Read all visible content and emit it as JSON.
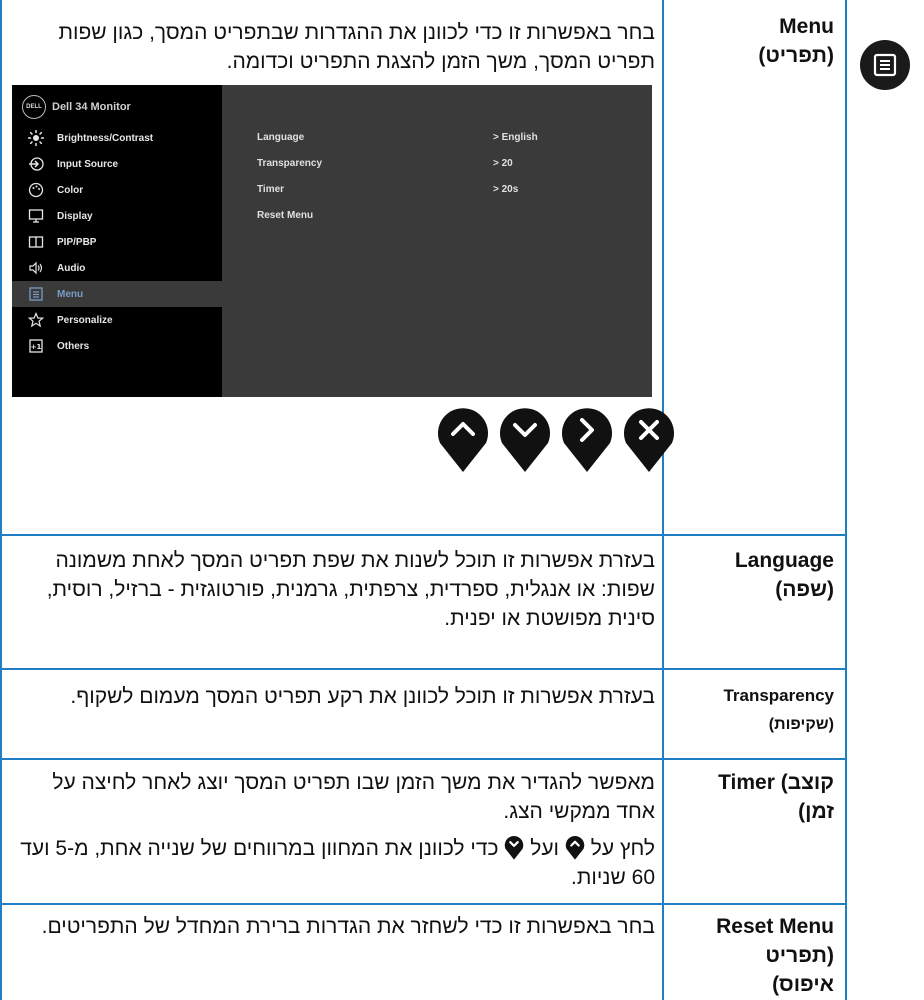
{
  "rows": {
    "menu": {
      "name_en": "Menu",
      "name_he": "(תפריט)",
      "desc": "בחר באפשרות זו כדי לכוונן את ההגדרות שבתפריט המסך, כגון שפות תפריט המסך, משך הזמן להצגת התפריט וכדומה."
    },
    "language": {
      "name_en": "Language",
      "name_he": "(שפה)",
      "desc": "בעזרת אפשרות זו תוכל לשנות את שפת תפריט המסך לאחת משמונה שפות: או אנגלית, ספרדית, צרפתית, גרמנית, פורטוגזית - ברזיל, רוסית, סינית מפושטת או יפנית."
    },
    "transparency": {
      "name_en": "Transparency",
      "name_he": "(שקיפות)",
      "desc": "בעזרת אפשרות זו תוכל לכוונן את רקע תפריט המסך מעמום לשקוף."
    },
    "timer": {
      "name_line1": "Timer (קוצב",
      "name_line2": "זמן)",
      "desc1": "מאפשר להגדיר את משך הזמן שבו תפריט המסך יוצג לאחר לחיצה על אחד ממקשי הצג.",
      "desc2_a": "לחץ על",
      "desc2_b": "ועל",
      "desc2_c": "כדי לכוונן את המחוון במרווחים של שנייה אחת, מ-5 ועד 60 שניות."
    },
    "reset": {
      "name_en": "Reset Menu",
      "name_he1": "(תפריט",
      "name_he2": "איפוס)",
      "desc": "בחר באפשרות זו כדי לשחזר את הגדרות ברירת המחדל של התפריטים."
    }
  },
  "osd": {
    "logo": "DELL",
    "title": "Dell 34 Monitor",
    "menu_items": [
      {
        "label": "Brightness/Contrast",
        "icon": "sun-icon"
      },
      {
        "label": "Input Source",
        "icon": "input-icon"
      },
      {
        "label": "Color",
        "icon": "palette-icon"
      },
      {
        "label": "Display",
        "icon": "display-icon"
      },
      {
        "label": "PIP/PBP",
        "icon": "pip-icon"
      },
      {
        "label": "Audio",
        "icon": "speaker-icon"
      },
      {
        "label": "Menu",
        "icon": "menu-icon"
      },
      {
        "label": "Personalize",
        "icon": "star-icon"
      },
      {
        "label": "Others",
        "icon": "others-icon"
      }
    ],
    "active_index": 6,
    "submenu": [
      {
        "label": "Language",
        "value": "> English"
      },
      {
        "label": "Transparency",
        "value": "> 20"
      },
      {
        "label": "Timer",
        "value": "> 20s"
      },
      {
        "label": "Reset Menu",
        "value": ""
      }
    ],
    "buttons": [
      "up-icon",
      "down-icon",
      "right-icon",
      "close-icon"
    ]
  },
  "colors": {
    "rule": "#1e7fc4",
    "osd_bg": "#3a3a3a",
    "osd_menu": "#000000",
    "active_text": "#7a9cc8"
  }
}
